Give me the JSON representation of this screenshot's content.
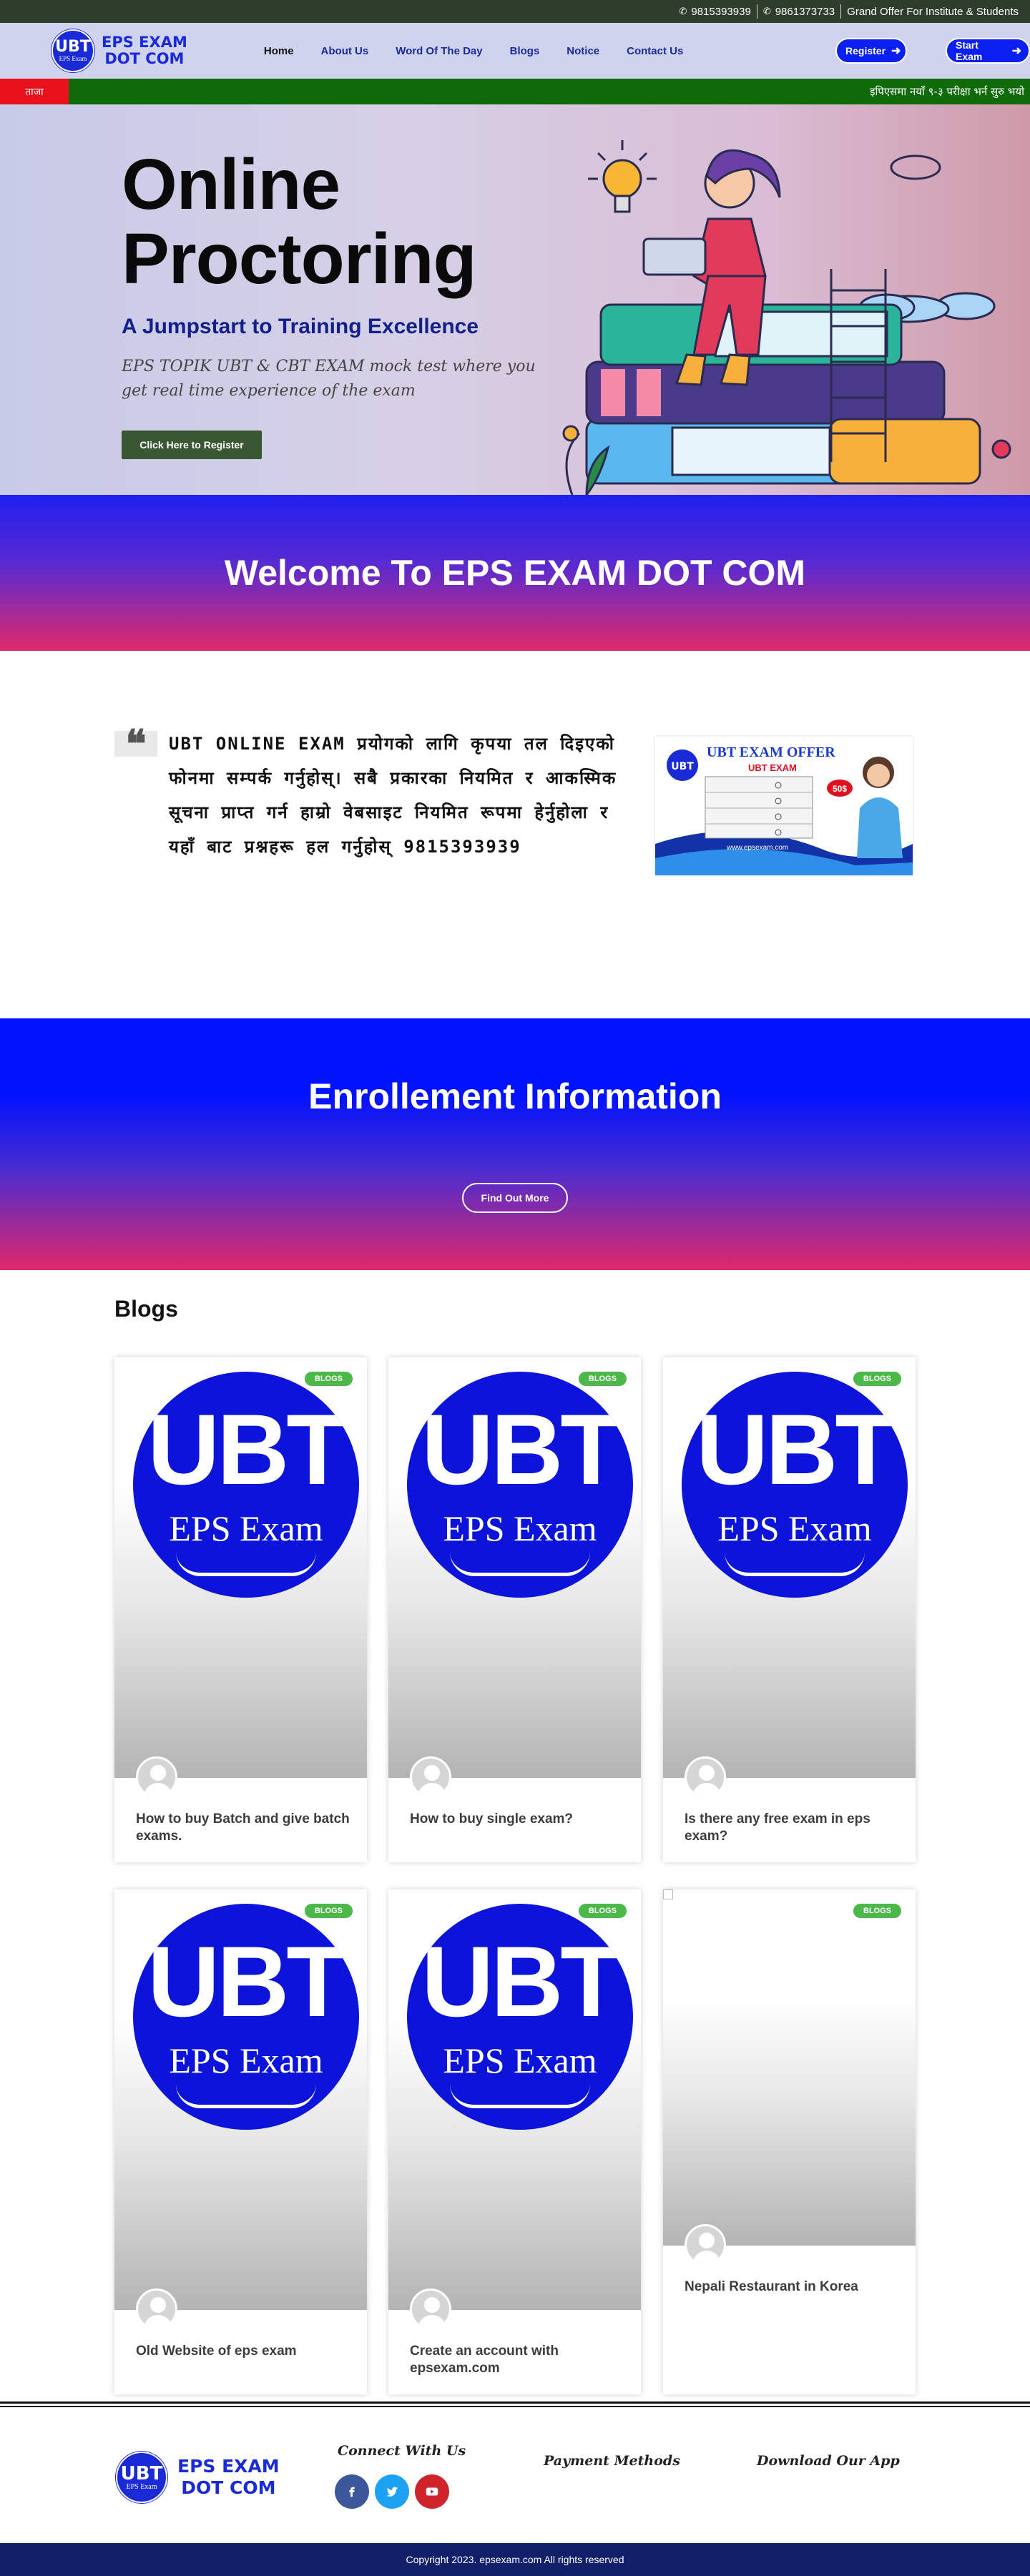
{
  "topbar": {
    "phone1": "9815393939",
    "phone2": "9861373733",
    "offer": "Grand Offer For Institute & Students"
  },
  "header": {
    "logo_badge_main": "UBT",
    "logo_badge_sub": "EPS Exam",
    "logo_line1": "EPS EXAM",
    "logo_line2": "DOT COM",
    "nav": [
      "Home",
      "About Us",
      "Word Of The Day",
      "Blogs",
      "Notice",
      "Contact Us"
    ],
    "register_label": "Register",
    "start_label": "Start Exam"
  },
  "ticker": {
    "label": "ताजा",
    "text": "इपिएसमा नयाँ ९-३ परीक्षा भर्न सुरु भयो"
  },
  "hero": {
    "title_line1": "Online",
    "title_line2": "Proctoring",
    "subtitle": "A Jumpstart to Training Excellence",
    "description": "EPS TOPIK UBT & CBT EXAM mock test where you get real time experience of the exam",
    "cta": "Click Here to Register"
  },
  "welcome": {
    "heading": "Welcome To EPS EXAM DOT COM"
  },
  "quote": {
    "text": "UBT ONLINE EXAM प्रयोगको लागि कृपया तल दिइएको फोनमा सम्पर्क गर्नुहोस्। सबै प्रकारका नियमित र आकस्मिक सूचना प्राप्त गर्न हाम्रो वेबसाइट नियमित रूपमा हेर्नुहोला र यहाँ बाट प्रश्नहरू हल गर्नुहोस् 9815393939",
    "offer_title": "UBT EXAM OFFER",
    "offer_sub": "UBT EXAM",
    "offer_price": "50$",
    "offer_url": "www.epsexam.com"
  },
  "enroll": {
    "heading": "Enrollement Information",
    "button": "Find Out More"
  },
  "blogs": {
    "title": "Blogs",
    "badge": "BLOGS",
    "logo_main": "UBT",
    "logo_sub": "EPS Exam",
    "posts": [
      "How to buy Batch and give batch exams.",
      "How to buy single exam?",
      "Is there any free exam in eps exam?",
      "Old Website of eps exam",
      "Create an account with epsexam.com",
      "Nepali Restaurant in Korea"
    ]
  },
  "footer": {
    "logo_badge_main": "UBT",
    "logo_badge_sub": "EPS Exam",
    "logo_line1": "EPS EXAM",
    "logo_line2": "DOT COM",
    "connect": "Connect With Us",
    "payment": "Payment Methods",
    "download": "Download Our App",
    "social": [
      "facebook-icon",
      "twitter-icon",
      "youtube-icon"
    ],
    "copyright": "Copyright 2023. epsexam.com All rights reserved"
  },
  "colors": {
    "brand_blue": "#1a2ad6",
    "nav_blue": "#1b2a9a",
    "green_badge": "#4cb84a",
    "ticker_green": "#0f6b0a",
    "ticker_red": "#e8101a",
    "footer_navy": "#12206a"
  }
}
